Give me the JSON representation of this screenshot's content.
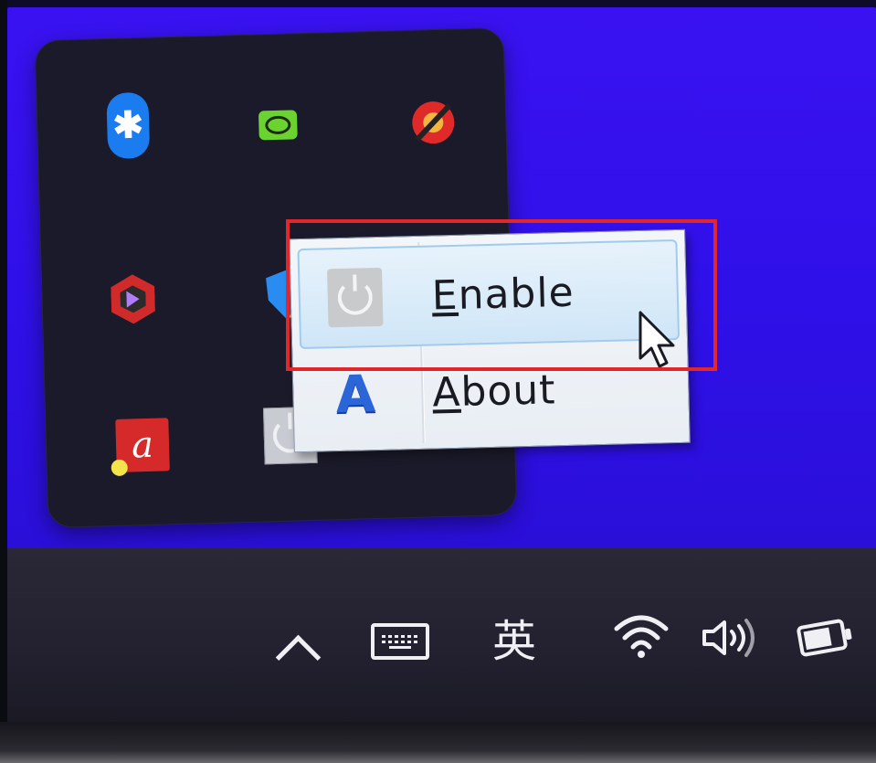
{
  "context_menu": {
    "items": [
      {
        "label": "Enable",
        "mnemonic": "E",
        "icon": "power-icon",
        "highlighted": true
      },
      {
        "label": "About",
        "mnemonic": "A",
        "icon": "app-a-icon",
        "highlighted": false
      }
    ]
  },
  "tray_overflow": {
    "icons": [
      "bluetooth-icon",
      "nvidia-icon",
      "blocked-app-icon",
      "hex-app-icon",
      "windows-security-icon",
      "avira-icon",
      "power-app-icon"
    ]
  },
  "taskbar": {
    "ime_indicator": "英",
    "icons": [
      "show-hidden-icons-chevron-icon",
      "touch-keyboard-icon",
      "ime-indicator",
      "wifi-icon",
      "volume-icon",
      "battery-icon"
    ]
  },
  "highlight_color": "#e1262c"
}
